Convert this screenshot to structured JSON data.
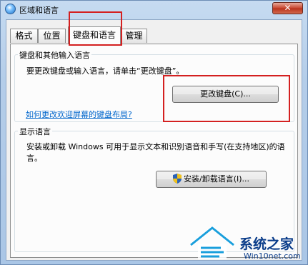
{
  "window": {
    "title": "区域和语言",
    "close_label": "✕"
  },
  "tabs": [
    {
      "label": "格式",
      "active": false
    },
    {
      "label": "位置",
      "active": false
    },
    {
      "label": "键盘和语言",
      "active": true
    },
    {
      "label": "管理",
      "active": false
    }
  ],
  "keyboard_group": {
    "title": "键盘和其他输入语言",
    "description": "要更改键盘或输入语言，请单击“更改键盘”。",
    "button_label": "更改键盘(C)...",
    "help_link": "如何更改欢迎屏幕的键盘布局?"
  },
  "display_group": {
    "title": "显示语言",
    "description_line1": "安装或卸载 Windows 可用于显示文本和识别语音和手写(在支持地区)的语",
    "description_line2": "言。",
    "button_label": "安装/卸载语言(I)..."
  },
  "watermark": {
    "text": "系统之家",
    "url": "Win10net.com"
  },
  "colors": {
    "annotation": "#d42020",
    "link": "#0066cc",
    "titlebar": "#b9d1ea"
  }
}
